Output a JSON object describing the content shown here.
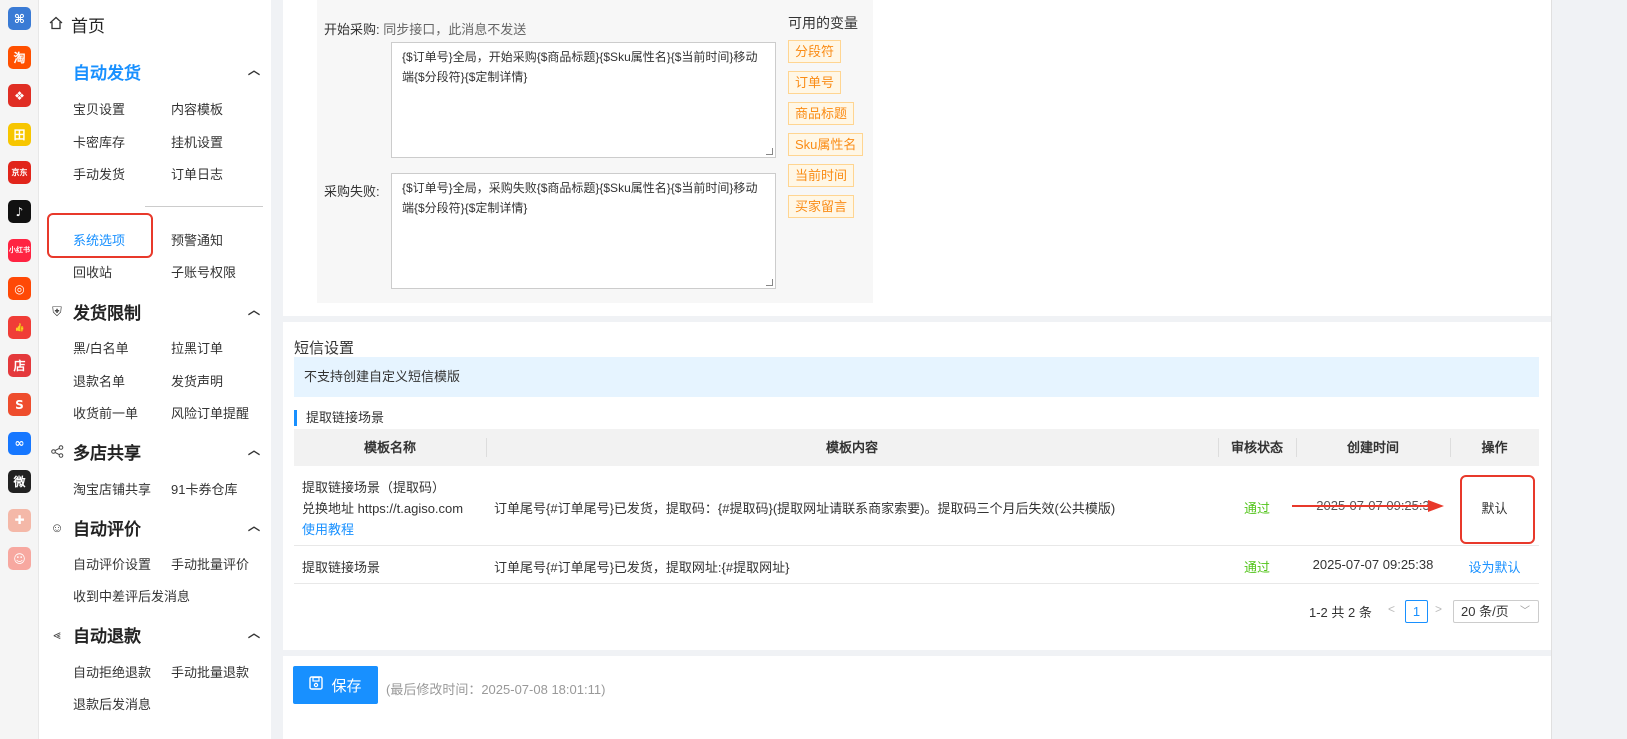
{
  "rail": {
    "icons": [
      {
        "name": "app-grid-icon",
        "glyph": "⌘",
        "color": "#3a7bd5"
      },
      {
        "name": "taobao-icon",
        "glyph": "淘",
        "color": "#ff5000"
      },
      {
        "name": "pinduoduo-icon",
        "glyph": "❖",
        "color": "#e02e24"
      },
      {
        "name": "store-yellow-icon",
        "glyph": "田",
        "color": "#f7c600"
      },
      {
        "name": "jd-icon",
        "glyph": "京东",
        "color": "#e1251b"
      },
      {
        "name": "douyin-icon",
        "glyph": "♪",
        "color": "#111111"
      },
      {
        "name": "xiaohongshu-icon",
        "glyph": "小红书",
        "color": "#ff2442"
      },
      {
        "name": "kuaishou-icon",
        "glyph": "◎",
        "color": "#ff4906"
      },
      {
        "name": "thumb-icon",
        "glyph": "👍",
        "color": "#f03d37"
      },
      {
        "name": "shop-icon",
        "glyph": "店",
        "color": "#e4393c"
      },
      {
        "name": "shopee-icon",
        "glyph": "S",
        "color": "#ee4d2d"
      },
      {
        "name": "link-icon",
        "glyph": "∞",
        "color": "#1677ff"
      },
      {
        "name": "weidian-icon",
        "glyph": "微",
        "color": "#222222"
      },
      {
        "name": "gift-icon",
        "glyph": "✚",
        "color": "#f4b8a8"
      },
      {
        "name": "face-icon",
        "glyph": "☺",
        "color": "#f7a8a0"
      }
    ]
  },
  "menu": {
    "home": "首页",
    "auto_ship": {
      "title": "自动发货",
      "items": [
        "宝贝设置",
        "内容模板",
        "卡密库存",
        "挂机设置",
        "手动发货",
        "订单日志",
        "系统选项",
        "预警通知",
        "回收站",
        "子账号权限"
      ]
    },
    "ship_limit": {
      "title": "发货限制",
      "items": [
        "黑/白名单",
        "拉黑订单",
        "退款名单",
        "发货声明",
        "收货前一单",
        "风险订单提醒"
      ]
    },
    "multi_shop": {
      "title": "多店共享",
      "items": [
        "淘宝店铺共享",
        "91卡券仓库"
      ]
    },
    "auto_review": {
      "title": "自动评价",
      "items": [
        "自动评价设置",
        "手动批量评价",
        "收到中差评后发消息"
      ]
    },
    "auto_refund": {
      "title": "自动退款",
      "items": [
        "自动拒绝退款",
        "手动批量退款",
        "退款后发消息"
      ]
    }
  },
  "templates": {
    "start_label": "开始采购:",
    "start_hint": "同步接口，此消息不发送",
    "start_text": "{$订单号}全局，开始采购{$商品标题}{$Sku属性名}{$当前时间}移动端{$分段符}{$定制详情}",
    "fail_label": "采购失败:",
    "fail_text": "{$订单号}全局，采购失败{$商品标题}{$Sku属性名}{$当前时间}移动端{$分段符}{$定制详情}",
    "vars_title": "可用的变量",
    "vars": [
      "分段符",
      "订单号",
      "商品标题",
      "Sku属性名",
      "当前时间",
      "买家留言"
    ]
  },
  "sms": {
    "title": "短信设置",
    "notice": "不支持创建自定义短信模版",
    "scene_title": "提取链接场景",
    "columns": [
      "模板名称",
      "模板内容",
      "审核状态",
      "创建时间",
      "操作"
    ],
    "rows": [
      {
        "name": "提取链接场景（提取码）",
        "sub": "兑换地址 https://t.agiso.com",
        "tutorial": "使用教程",
        "content": "订单尾号{#订单尾号}已发货，提取码：{#提取码}(提取网址请联系商家索要)。提取码三个月后失效(公共模版)",
        "status": "通过",
        "created": "2025-07-07 09:25:3",
        "action": "默认"
      },
      {
        "name": "提取链接场景",
        "content": "订单尾号{#订单尾号}已发货，提取网址:{#提取网址}",
        "status": "通过",
        "created": "2025-07-07 09:25:38",
        "action": "设为默认"
      }
    ],
    "pagination": {
      "total": "1-2 共 2 条",
      "prev": "<",
      "current": "1",
      "next": ">",
      "page_size": "20 条/页"
    }
  },
  "footer": {
    "save_label": "保存",
    "last_modified": "(最后修改时间：2025-07-08 18:01:11)"
  },
  "colors": {
    "primary": "#1890ff",
    "annotation_red": "#e8392b",
    "tag_orange": "#fa8c16",
    "status_green": "#52c41a"
  }
}
